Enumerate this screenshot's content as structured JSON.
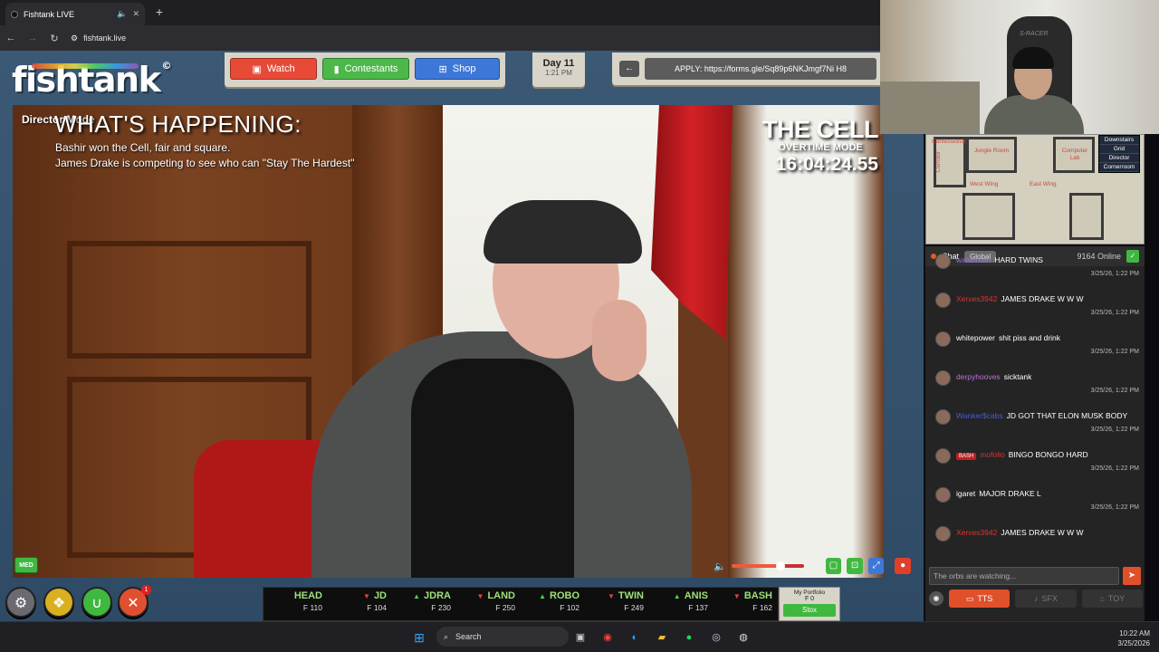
{
  "browser": {
    "tab_title": "Fishtank LIVE",
    "mute_icon": "speaker-icon",
    "close_icon": "close-icon",
    "new_tab": "+",
    "url": "fishtank.live"
  },
  "header": {
    "logo_text": "fishtank",
    "logo_mark": "©",
    "nav": [
      {
        "label": "Watch",
        "color": "#e84a38"
      },
      {
        "label": "Contestants",
        "color": "#4cb84a"
      },
      {
        "label": "Shop",
        "color": "#3d78d8"
      }
    ],
    "day": "Day 11",
    "time": "1:21 PM",
    "apply_text": "APPLY: https://forms.gle/Sq89p6NKJmgf7Ni H8"
  },
  "video": {
    "mode_label": "Director Mode",
    "happening_title": "WHAT'S HAPPENING:",
    "happening_lines": [
      "Bashir won the Cell, fair and square.",
      "James Drake is competing to see who can \"Stay The Hardest\""
    ],
    "cell_title": "THE CELL",
    "cell_mode": "OVERTIME MODE",
    "cell_timer": "16:04:24.55",
    "quality_badge": "MED",
    "volume_level": 0.68
  },
  "bottom_buttons": {
    "notification_count": "1",
    "icons": [
      "gear-icon",
      "coins-icon",
      "magnet-icon",
      "tools-icon"
    ]
  },
  "stox": {
    "items": [
      {
        "name": "HEAD",
        "value": "110",
        "dir": ""
      },
      {
        "name": "JD",
        "value": "104",
        "dir": "down"
      },
      {
        "name": "JDRA",
        "value": "230",
        "dir": "up"
      },
      {
        "name": "LAND",
        "value": "250",
        "dir": "down"
      },
      {
        "name": "ROBO",
        "value": "102",
        "dir": "up"
      },
      {
        "name": "TWIN",
        "value": "249",
        "dir": "down"
      },
      {
        "name": "ANIS",
        "value": "137",
        "dir": "up"
      },
      {
        "name": "BASH",
        "value": "162",
        "dir": "down"
      }
    ],
    "currency": "F",
    "portfolio_label": "My Portfolio",
    "portfolio_value": "F 0",
    "stox_button": "Stox"
  },
  "map": {
    "rooms": [
      "Confessional",
      "Jungle Room",
      "Computer Lab",
      "Corridor",
      "West Wing",
      "East Wing"
    ],
    "legend": [
      "Downstairs",
      "Grid",
      "Director",
      "Cornerroom"
    ]
  },
  "chat": {
    "title": "Chat",
    "tab_global": "Global",
    "online": "9164 Online",
    "messages": [
      {
        "user": "walshman",
        "user_color": "#9a7ad8",
        "text": "HARD TWINS",
        "time": "3/25/26, 1:22 PM",
        "tag": ""
      },
      {
        "user": "Xerxes3942",
        "user_color": "#e03030",
        "text": "JAMES DRAKE W W W",
        "time": "3/25/26, 1:22 PM",
        "tag": ""
      },
      {
        "user": "whitepower",
        "user_color": "#ffffff",
        "text": "shit piss and drink",
        "time": "3/25/26, 1:22 PM",
        "tag": ""
      },
      {
        "user": "derpyhooves",
        "user_color": "#c070e0",
        "text": "sicktank",
        "time": "3/25/26, 1:22 PM",
        "tag": ""
      },
      {
        "user": "Wanker$cabs",
        "user_color": "#4a5ad8",
        "text": "JD GOT THAT ELON MUSK BODY",
        "time": "3/25/26, 1:22 PM",
        "tag": ""
      },
      {
        "user": "mofolio",
        "user_color": "#e03030",
        "text": "BINGO BONGO HARD",
        "time": "3/25/26, 1:22 PM",
        "tag": "BASH"
      },
      {
        "user": "igaret",
        "user_color": "#ffffff",
        "text": "MAJOR DRAKE L",
        "time": "3/25/26, 1:22 PM",
        "tag": ""
      },
      {
        "user": "Xerxes3942",
        "user_color": "#e03030",
        "text": "JAMES DRAKE W W W",
        "time": "3/25/26, 1:22 PM",
        "tag": ""
      }
    ],
    "input_placeholder": "The orbs are watching...",
    "footer": [
      {
        "label": "TTS",
        "active": true
      },
      {
        "label": "SFX",
        "active": false
      },
      {
        "label": "TOY",
        "active": false
      }
    ]
  },
  "taskbar": {
    "search_label": "Search",
    "time": "10:22 AM",
    "date": "3/25/2026"
  }
}
